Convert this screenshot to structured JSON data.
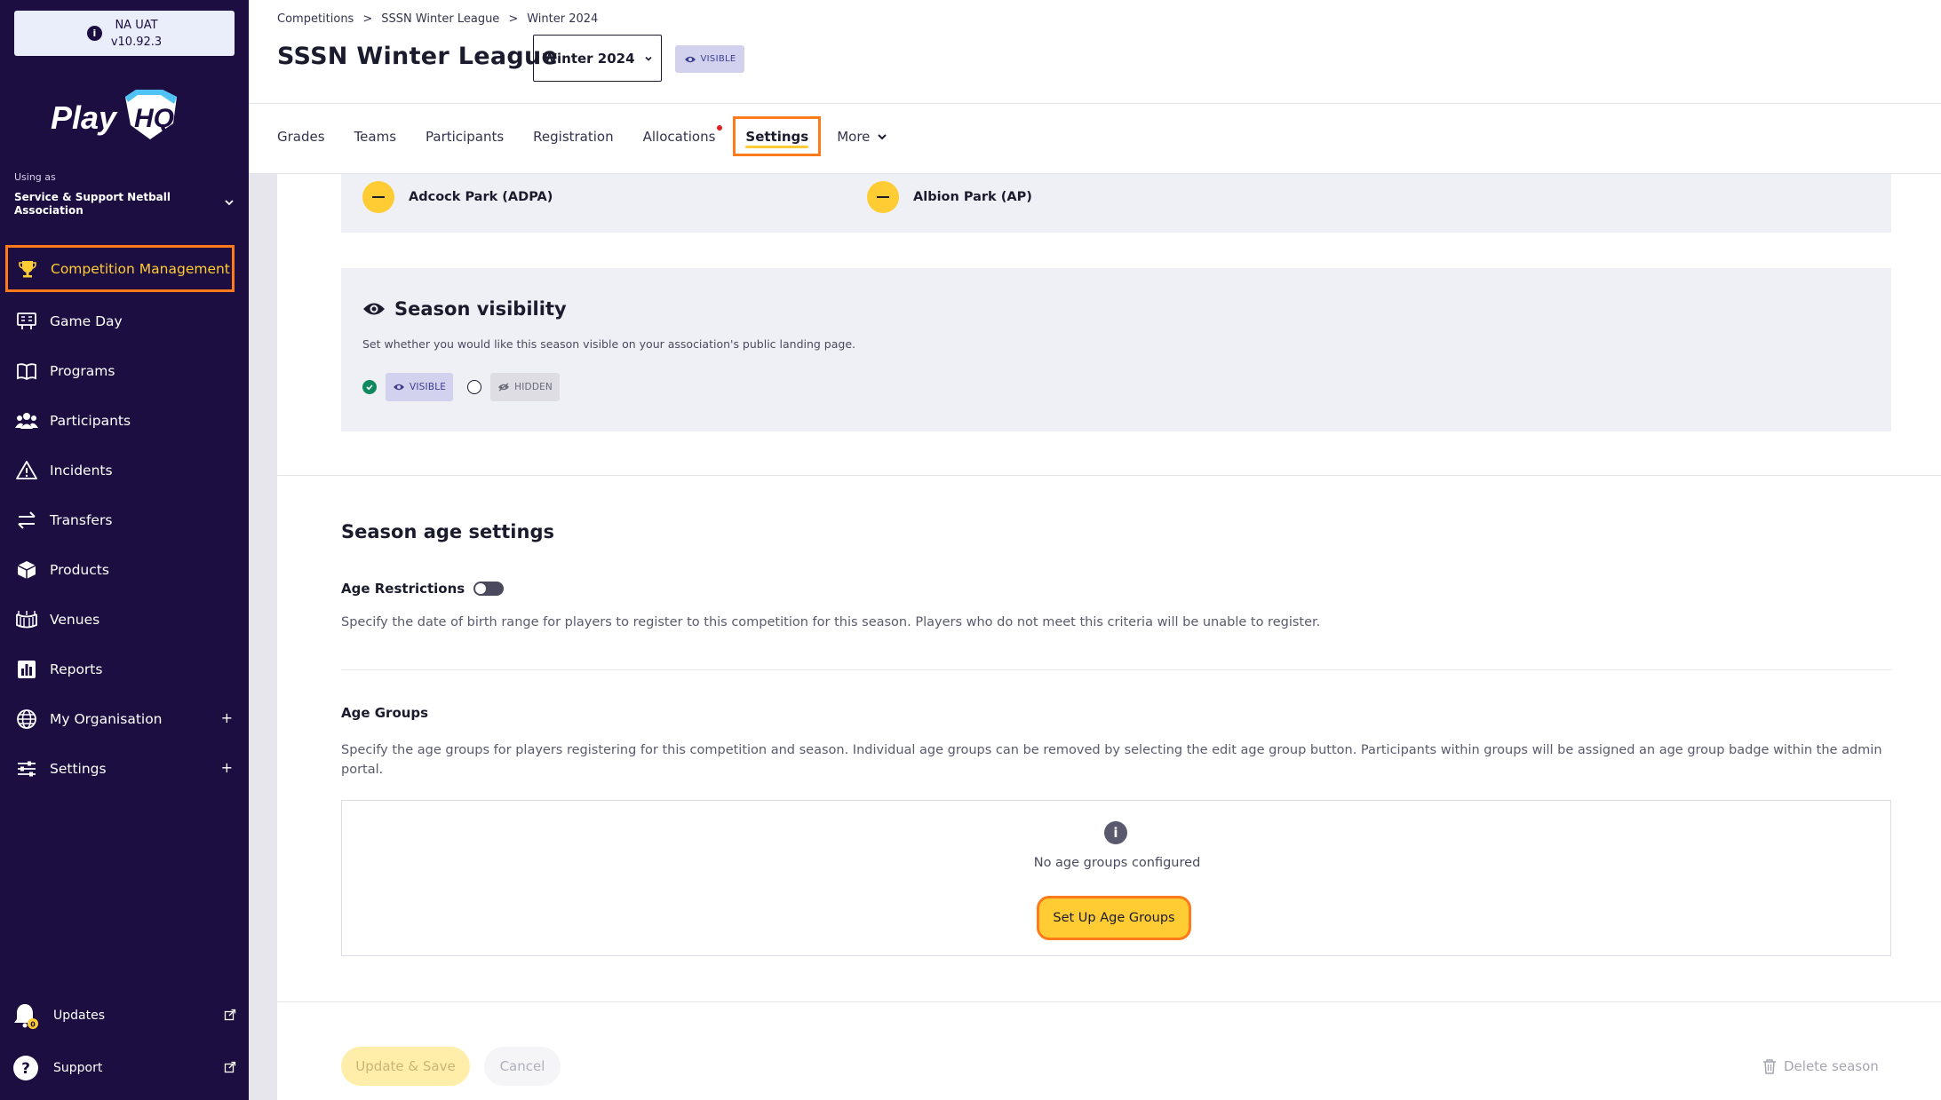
{
  "env": {
    "name": "NA UAT",
    "version": "v10.92.3"
  },
  "brand": {
    "logo_text": "PlayHQ",
    "accent": "#ffcc33",
    "highlight": "#ff7a1a",
    "sidebar_bg": "#1c0e41"
  },
  "account": {
    "using_as_label": "Using as",
    "org_name": "Service & Support Netball Association"
  },
  "nav": {
    "items": [
      {
        "label": "Competition Management",
        "icon": "trophy-icon",
        "active": true
      },
      {
        "label": "Game Day",
        "icon": "scoreboard-icon"
      },
      {
        "label": "Programs",
        "icon": "book-icon"
      },
      {
        "label": "Participants",
        "icon": "people-icon"
      },
      {
        "label": "Incidents",
        "icon": "warning-icon"
      },
      {
        "label": "Transfers",
        "icon": "transfer-icon"
      },
      {
        "label": "Products",
        "icon": "box-icon"
      },
      {
        "label": "Venues",
        "icon": "stadium-icon"
      },
      {
        "label": "Reports",
        "icon": "report-icon"
      },
      {
        "label": "My Organisation",
        "icon": "globe-icon",
        "expandable": true,
        "expand_symbol": "+"
      },
      {
        "label": "Settings",
        "icon": "sliders-icon",
        "expandable": true,
        "expand_symbol": "+"
      }
    ],
    "updates_label": "Updates",
    "support_label": "Support"
  },
  "breadcrumb": [
    "Competitions",
    "SSSN Winter League",
    "Winter 2024"
  ],
  "breadcrumb_sep": ">",
  "page": {
    "title": "SSSN Winter League",
    "season_selected": "Winter 2024",
    "visibility_badge": "VISIBLE"
  },
  "tabs": [
    {
      "label": "Grades"
    },
    {
      "label": "Teams"
    },
    {
      "label": "Participants"
    },
    {
      "label": "Registration"
    },
    {
      "label": "Allocations",
      "notification": true
    },
    {
      "label": "Settings",
      "active": true
    },
    {
      "label": "More",
      "dropdown": true
    }
  ],
  "venues": [
    {
      "name": "Adcock Park (ADPA)"
    },
    {
      "name": "Albion Park (AP)"
    }
  ],
  "season_visibility": {
    "title": "Season visibility",
    "description": "Set whether you would like this season visible on your association's public landing page.",
    "options": [
      {
        "label": "VISIBLE",
        "selected": true
      },
      {
        "label": "HIDDEN",
        "selected": false
      }
    ]
  },
  "age_settings": {
    "title": "Season age settings",
    "restrictions_label": "Age Restrictions",
    "restrictions_enabled": false,
    "restrictions_description": "Specify the date of birth range for players to register to this competition for this season. Players who do not meet this criteria will be unable to register.",
    "groups_title": "Age Groups",
    "groups_description": "Specify the age groups for players registering for this competition and season. Individual age groups can be removed by selecting the edit age group button. Participants within groups will be assigned an age group badge within the admin portal.",
    "empty_text": "No age groups configured",
    "setup_button": "Set Up Age Groups"
  },
  "footer": {
    "update_save": "Update & Save",
    "cancel": "Cancel",
    "delete_season": "Delete season"
  }
}
